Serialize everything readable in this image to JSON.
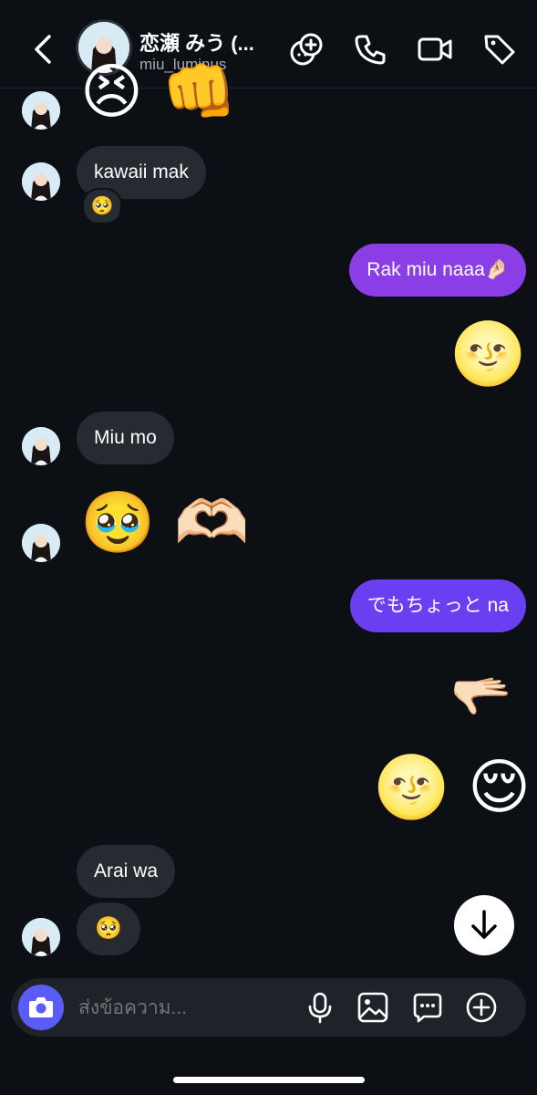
{
  "header": {
    "title": "恋瀬 みう (...",
    "username": "miu_luminus"
  },
  "messages": {
    "m1_emojis": "😣 👊",
    "m2_text": "kawaii mak",
    "m2_reaction": "🥺",
    "m3_text": "Rak miu naaa🤌🏻",
    "m4_emoji": "🌝",
    "m5_text": "Miu mo",
    "m6_emojis": "🥹 🫶🏻",
    "m7_text": "でもちょっと na",
    "m8_emoji": "🫳🏻",
    "m9_emojis": "🌝 😌",
    "m10_text": "Arai wa",
    "m11_emoji": "🥺"
  },
  "composer": {
    "placeholder": "ส่งข้อความ..."
  },
  "colors": {
    "background": "#0c0f14",
    "incoming_bubble": "#262a31",
    "outgoing_purple": "#8b3ee6",
    "outgoing_violet": "#6a3ff2",
    "camera_button": "#5a5cf6"
  },
  "icons": [
    "back-icon",
    "video-chat-effects-icon",
    "phone-icon",
    "video-icon",
    "tag-icon",
    "arrow-down-icon",
    "camera-icon",
    "microphone-icon",
    "image-icon",
    "sticker-chat-icon",
    "plus-icon"
  ]
}
